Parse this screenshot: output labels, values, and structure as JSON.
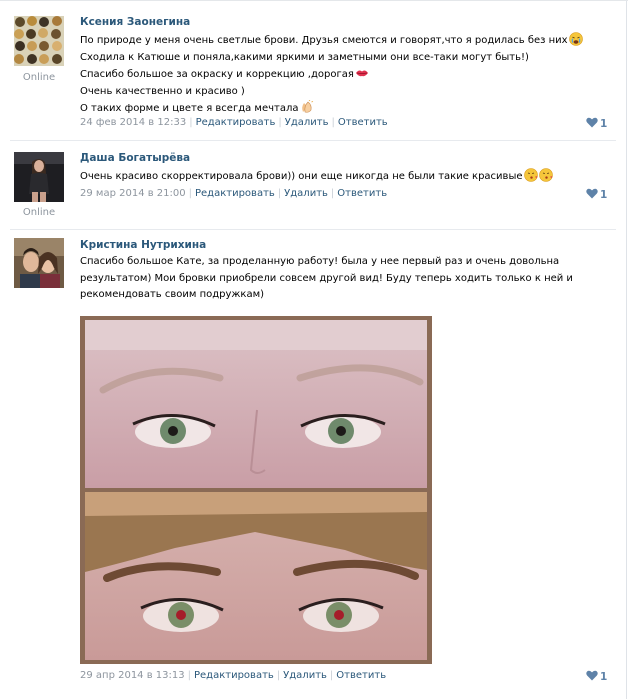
{
  "comments": [
    {
      "author": "Ксения Заонегина",
      "status": "Online",
      "lines": [
        "По природе у меня очень светлые брови. Друзья смеются и говорят,что я родилась без них",
        "Сходила к Катюше и поняла,какими яркими и заметными они все-таки могут быть!)",
        "Спасибо большое за окраску и коррекцию ,дорогая",
        "Очень качественно и красиво )",
        "О таких форме и цвете я всегда мечтала"
      ],
      "emoji_names": [
        "crying-face-icon",
        "kiss-lips-icon",
        "clapping-hands-icon"
      ],
      "date": "24 фев 2014 в 12:33",
      "actions": [
        "Редактировать",
        "Удалить",
        "Ответить"
      ],
      "likes": "1"
    },
    {
      "author": "Даша Богатырёва",
      "status": "Online",
      "lines": [
        "Очень красиво скорректировала брови)) они еще никогда не были такие красивые"
      ],
      "emoji_names": [
        "kissing-face-icon",
        "kissing-face-icon"
      ],
      "date": "29 мар 2014 в 21:00",
      "actions": [
        "Редактировать",
        "Удалить",
        "Ответить"
      ],
      "likes": "1"
    },
    {
      "author": "Кристина Нутрихина",
      "lines": [
        "Спасибо большое Кате, за проделанную работу! была у нее первый раз и очень довольна",
        "результатом) Мои бровки приобрели совсем другой вид! Буду теперь ходить только к ней и",
        "рекомендовать своим подружкам)"
      ],
      "photo_name": "before-after-eyebrows-photo",
      "date": "29 апр 2014 в 13:13",
      "actions": [
        "Редактировать",
        "Удалить",
        "Ответить"
      ],
      "likes": "1"
    }
  ],
  "colors": {
    "author_link": "#2b587a",
    "meta_gray": "#8d959e",
    "like_blue": "#5e82a8",
    "separator": "#e7eaee"
  }
}
